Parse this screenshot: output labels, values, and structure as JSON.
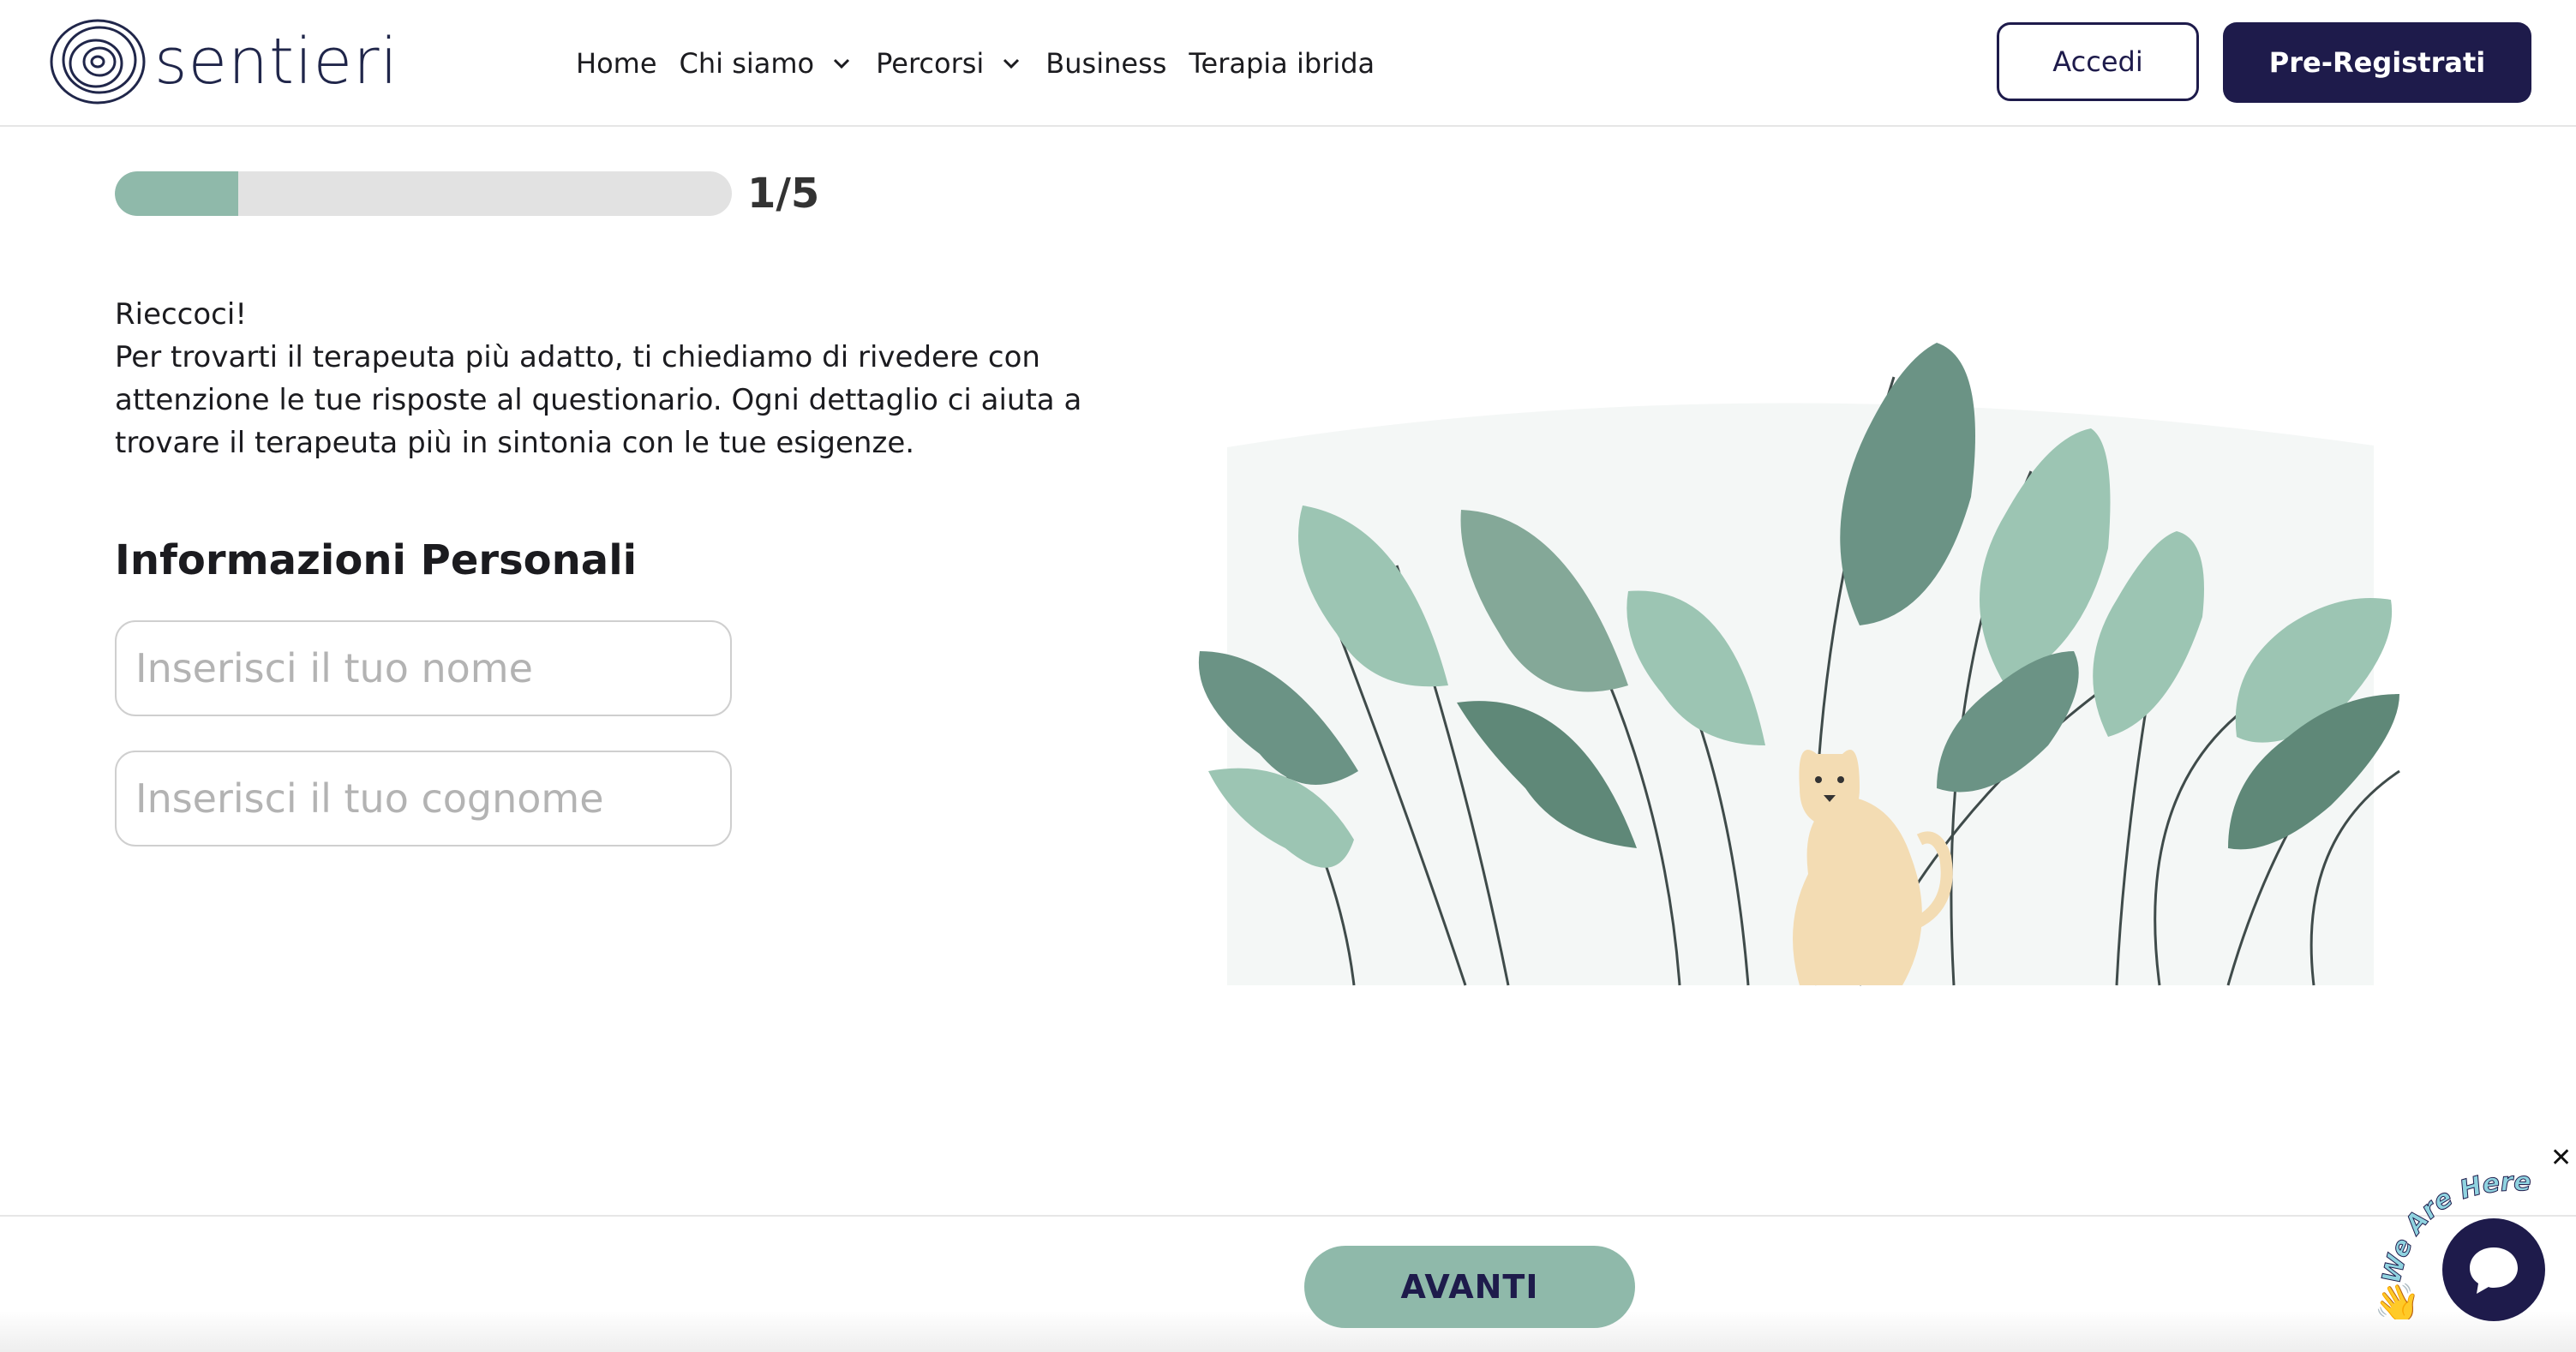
{
  "header": {
    "logo_text": "sentieri",
    "nav": [
      {
        "label": "Home"
      },
      {
        "label": "Chi siamo"
      },
      {
        "label": "Percorsi"
      },
      {
        "label": "Business"
      },
      {
        "label": "Terapia ibrida"
      }
    ],
    "login_label": "Accedi",
    "preregister_label": "Pre-Registrati"
  },
  "progress": {
    "current": 1,
    "total": 5,
    "label": "1/5"
  },
  "intro": {
    "line1": "Rieccoci!",
    "line2": "Per trovarti il terapeuta più adatto, ti chiediamo di rivedere con attenzione le tue risposte al questionario. Ogni dettaglio ci aiuta a trovare il terapeuta più in sintonia con le tue esigenze."
  },
  "form": {
    "section_title": "Informazioni Personali",
    "first_name": {
      "value": "",
      "placeholder": "Inserisci il tuo nome"
    },
    "last_name": {
      "value": "",
      "placeholder": "Inserisci il tuo cognome"
    }
  },
  "footer": {
    "next_label": "AVANTI"
  },
  "chat": {
    "tag_text": "We Are Here!",
    "close_symbol": "✕"
  },
  "colors": {
    "brand_navy": "#1e1b4b",
    "accent_green": "#8fb9aa",
    "leaf_dark": "#6b9385",
    "leaf_light": "#9cc5b3",
    "cat": "#f3dcb3"
  }
}
